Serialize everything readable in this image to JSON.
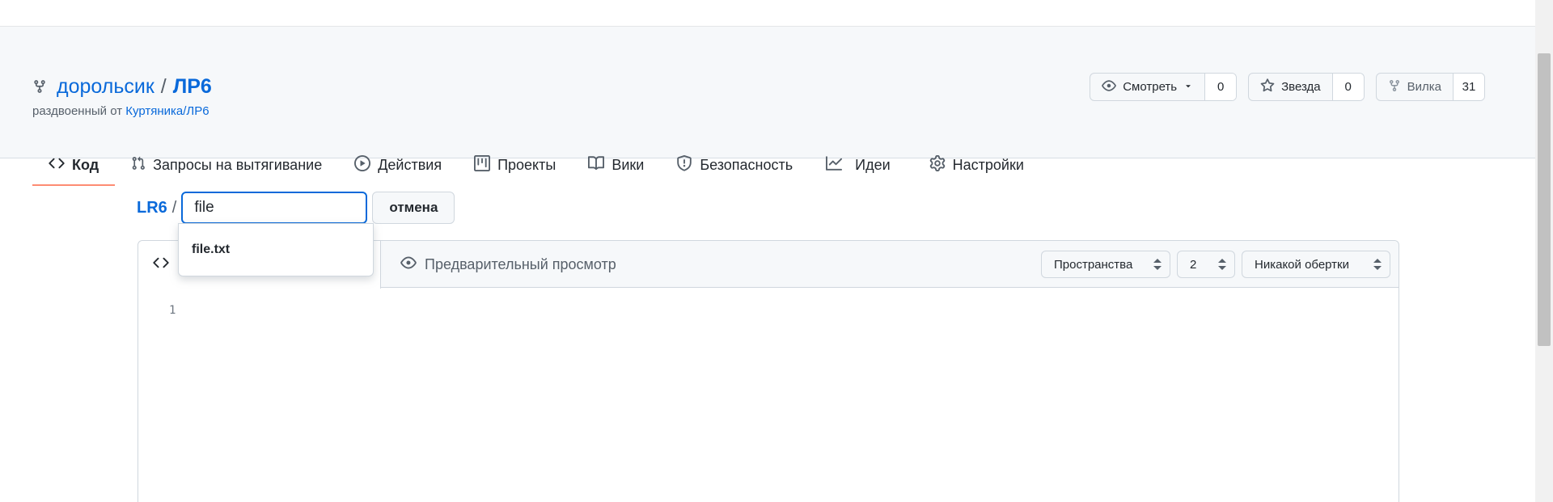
{
  "repo": {
    "owner": "дорольсик",
    "separator": "/",
    "name": "ЛР6",
    "forked_prefix": "раздвоенный от ",
    "forked_from": "Куртяника/ЛР6"
  },
  "actions": {
    "watch_label": "Смотреть",
    "watch_count": "0",
    "star_label": "Звезда",
    "star_count": "0",
    "fork_label": "Вилка",
    "fork_count": "31"
  },
  "tabs": [
    {
      "label": "Код",
      "icon": "code-icon",
      "active": true
    },
    {
      "label": "Запросы на вытягивание",
      "icon": "pull-request-icon"
    },
    {
      "label": "Действия",
      "icon": "play-icon"
    },
    {
      "label": "Проекты",
      "icon": "project-icon"
    },
    {
      "label": "Вики",
      "icon": "book-icon"
    },
    {
      "label": "Безопасность",
      "icon": "shield-icon"
    },
    {
      "label": "Идеи",
      "icon": "graph-icon"
    },
    {
      "label": "Настройки",
      "icon": "gear-icon"
    }
  ],
  "editor": {
    "breadcrumb_root": "LR6",
    "breadcrumb_sep": "/",
    "filename_value": "file",
    "cancel_label": "отмена",
    "suggestion": "file.txt",
    "preview_label": "Предварительный просмотр",
    "indent_mode": "Пространства",
    "indent_size": "2",
    "wrap_mode": "Никакой обертки",
    "line_number": "1"
  },
  "colors": {
    "accent": "#0969da",
    "active_tab_underline": "#fd8c73",
    "header_bg": "#f6f8fa"
  }
}
